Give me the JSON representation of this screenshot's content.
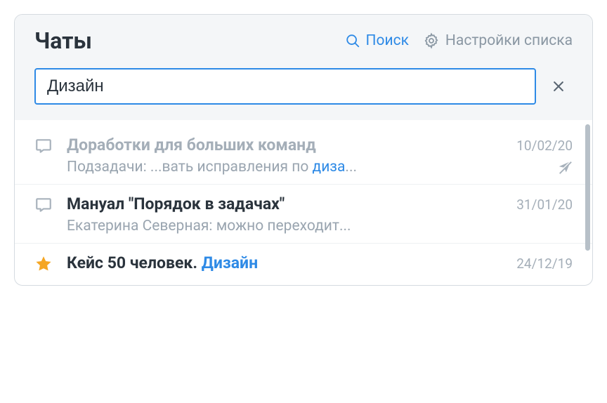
{
  "header": {
    "title": "Чаты",
    "search_label": "Поиск",
    "settings_label": "Настройки списка"
  },
  "search": {
    "value": "Дизайн"
  },
  "items": [
    {
      "icon": "chat",
      "title_pre": "Доработки для больших команд",
      "title_hl": "",
      "title_post": "",
      "muted": true,
      "date": "10/02/20",
      "sub_pre": "Подзадачи: ...вать исправления по ",
      "sub_hl": "диза",
      "sub_post": "...",
      "muted_badge": true
    },
    {
      "icon": "chat",
      "title_pre": "Мануал \"Порядок в задачах\"",
      "title_hl": "",
      "title_post": "",
      "muted": false,
      "date": "31/01/20",
      "sub_pre": "Екатерина Северная: можно переходит...",
      "sub_hl": "",
      "sub_post": "",
      "muted_badge": false
    },
    {
      "icon": "star",
      "title_pre": "Кейс 50 человек. ",
      "title_hl": "Дизайн",
      "title_post": "",
      "muted": false,
      "date": "24/12/19",
      "sub_pre": "",
      "sub_hl": "",
      "sub_post": "",
      "muted_badge": false
    }
  ]
}
